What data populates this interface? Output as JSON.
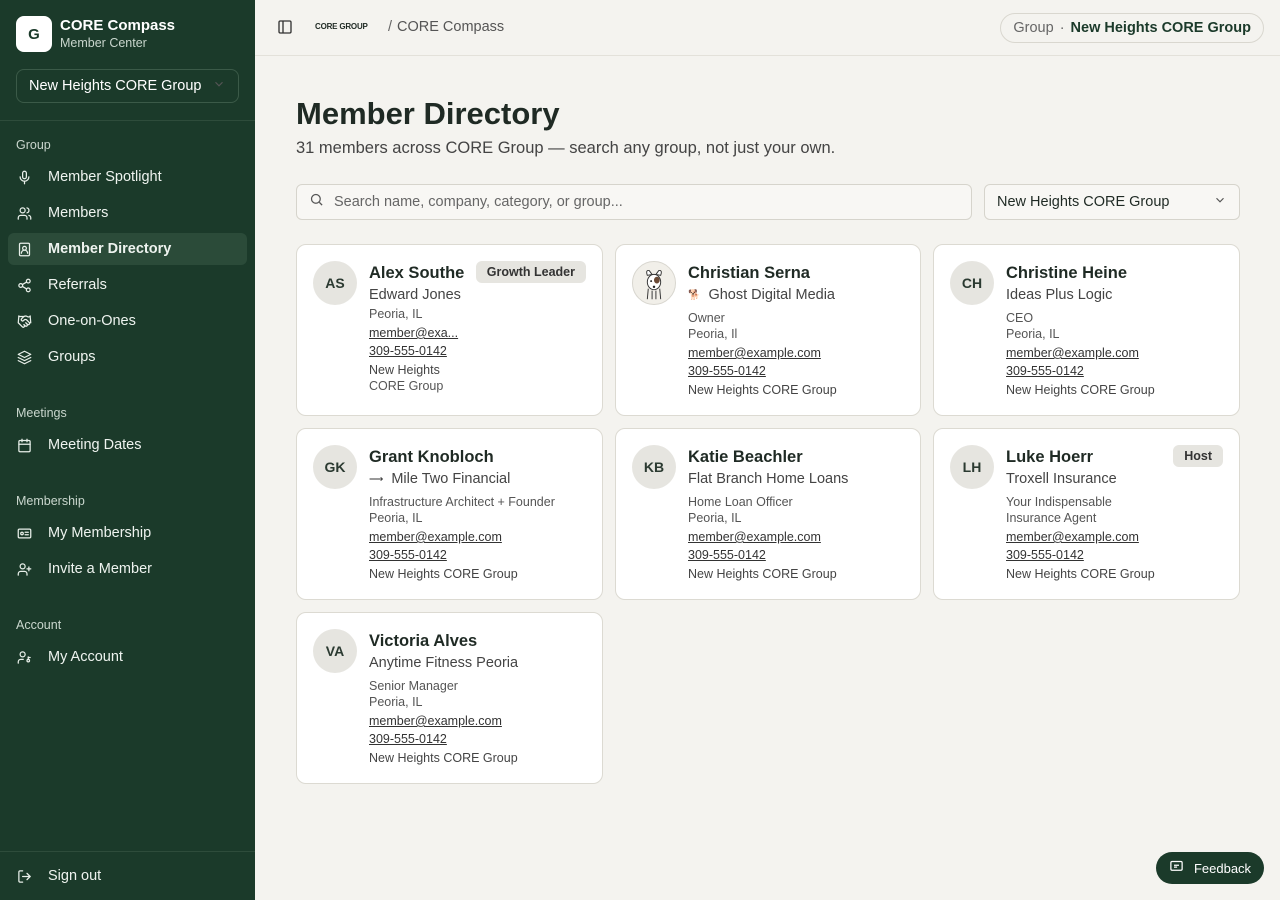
{
  "sidebar": {
    "brand_initial": "G",
    "brand_name": "CORE Compass",
    "brand_sub": "Member Center",
    "group_selector": "New Heights CORE Group",
    "sections": {
      "group": "Group",
      "meetings": "Meetings",
      "membership": "Membership",
      "account": "Account"
    },
    "items": [
      {
        "label": "Member Spotlight",
        "icon": "microphone-icon"
      },
      {
        "label": "Members",
        "icon": "users-icon"
      },
      {
        "label": "Member Directory",
        "icon": "contact-book-icon"
      },
      {
        "label": "Referrals",
        "icon": "share-icon"
      },
      {
        "label": "One-on-Ones",
        "icon": "handshake-icon"
      },
      {
        "label": "Groups",
        "icon": "layers-icon"
      },
      {
        "label": "Meeting Dates",
        "icon": "calendar-icon"
      },
      {
        "label": "My Membership",
        "icon": "id-card-icon"
      },
      {
        "label": "Invite a Member",
        "icon": "user-plus-icon"
      },
      {
        "label": "My Account",
        "icon": "user-key-icon"
      }
    ],
    "sign_out": "Sign out"
  },
  "topbar": {
    "logo_text": "CORE GROUP",
    "separator": "/",
    "crumb": "CORE Compass",
    "pill_label": "Group",
    "pill_dot": "·",
    "pill_value": "New Heights CORE Group"
  },
  "main": {
    "title": "Member Directory",
    "subtitle": "31 members across CORE Group — search any group, not just your own.",
    "search_placeholder": "Search name, company, category, or group...",
    "filter_value": "New Heights CORE Group"
  },
  "members": [
    {
      "initials": "AS",
      "name": "Alex Southe",
      "company": "Edward Jones",
      "role": "",
      "location": "Peoria, IL",
      "email": "member@exa...",
      "phone": "309-555-0142",
      "group_line1": "New Heights",
      "group_line2": "CORE Group",
      "badge": "Growth Leader"
    },
    {
      "initials": "",
      "name": "Christian Serna",
      "company": "Ghost Digital Media",
      "role": "Owner",
      "location": "Peoria, Il",
      "email": "member@example.com",
      "phone": "309-555-0142",
      "group_line1": "New Heights CORE Group",
      "group_line2": "",
      "badge": ""
    },
    {
      "initials": "CH",
      "name": "Christine Heine",
      "company": "Ideas Plus Logic",
      "role": "CEO",
      "location": "Peoria, IL",
      "email": "member@example.com",
      "phone": "309-555-0142",
      "group_line1": "New Heights CORE Group",
      "group_line2": "",
      "badge": ""
    },
    {
      "initials": "GK",
      "name": "Grant Knobloch",
      "company": "Mile Two Financial",
      "role": "Infrastructure Architect + Founder",
      "location": "Peoria, IL",
      "email": "member@example.com",
      "phone": "309-555-0142",
      "group_line1": "New Heights CORE Group",
      "group_line2": "",
      "badge": ""
    },
    {
      "initials": "KB",
      "name": "Katie Beachler",
      "company": "Flat Branch Home Loans",
      "role": "Home Loan Officer",
      "location": "Peoria, IL",
      "email": "member@example.com",
      "phone": "309-555-0142",
      "group_line1": "New Heights CORE Group",
      "group_line2": "",
      "badge": ""
    },
    {
      "initials": "LH",
      "name": "Luke Hoerr",
      "company": "Troxell Insurance",
      "role_line1": "Your Indispensable",
      "role_line2": "Insurance Agent",
      "email": "member@example.com",
      "phone": "309-555-0142",
      "group_line1": "New Heights CORE Group",
      "group_line2": "",
      "badge": "Host"
    },
    {
      "initials": "VA",
      "name": "Victoria Alves",
      "company": "Anytime Fitness Peoria",
      "role": "Senior Manager",
      "location": "Peoria, IL",
      "email": "member@example.com",
      "phone": "309-555-0142",
      "group_line1": "New Heights CORE Group",
      "group_line2": "",
      "badge": ""
    }
  ],
  "feedback": "Feedback"
}
